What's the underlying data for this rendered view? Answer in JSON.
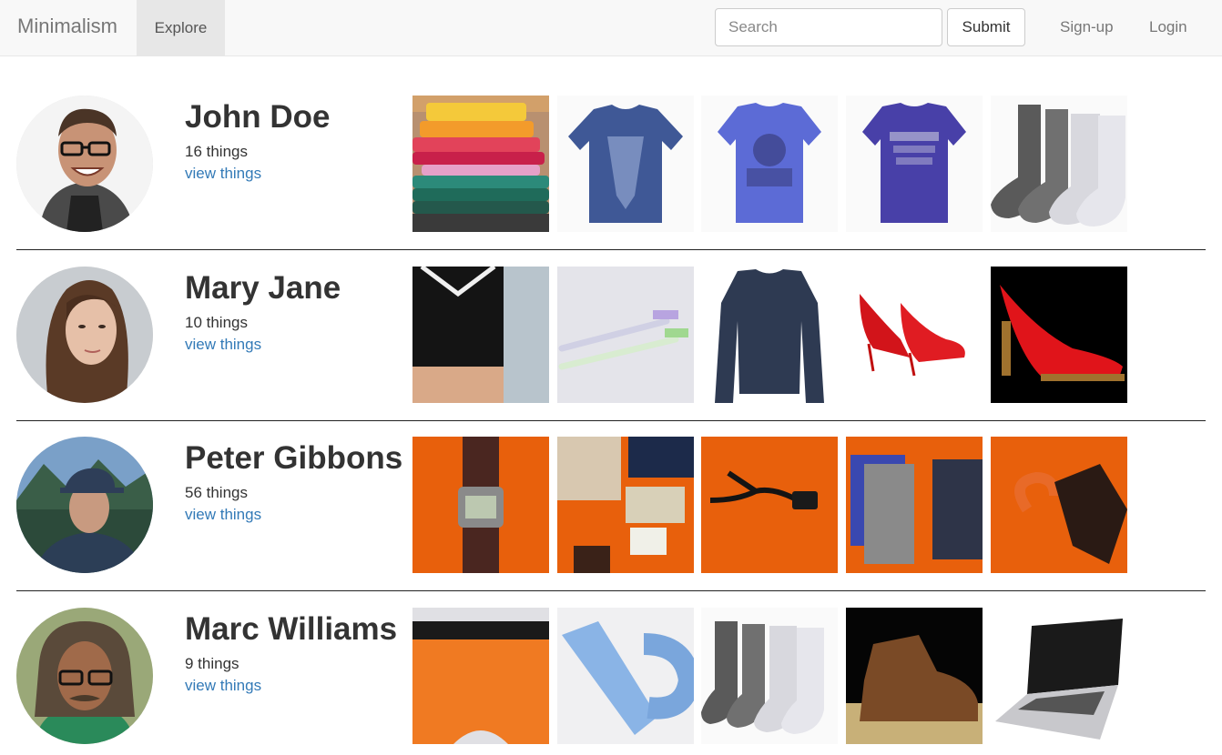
{
  "nav": {
    "brand": "Minimalism",
    "explore": "Explore",
    "search_placeholder": "Search",
    "submit": "Submit",
    "signup": "Sign-up",
    "login": "Login"
  },
  "users": [
    {
      "name": "John Doe",
      "count": "16 things",
      "link": "view things",
      "things": [
        "folded-shirts-photo",
        "eagle-tshirt-photo",
        "graphic-tshirt-photo",
        "bestsupply-tshirt-photo",
        "socks-photo"
      ]
    },
    {
      "name": "Mary Jane",
      "count": "10 things",
      "link": "view things",
      "things": [
        "sports-top-photo",
        "toothbrushes-photo",
        "sweater-photo",
        "red-heels-photo",
        "red-pump-photo"
      ]
    },
    {
      "name": "Peter Gibbons",
      "count": "56 things",
      "link": "view things",
      "things": [
        "watch-photo",
        "passport-wallet-photo",
        "charger-cable-photo",
        "underwear-photo",
        "umbrella-photo"
      ]
    },
    {
      "name": "Marc Williams",
      "count": "9 things",
      "link": "view things",
      "things": [
        "orange-briefs-photo",
        "blue-tie-photo",
        "socks-photo",
        "leather-boot-photo",
        "laptop-photo"
      ]
    }
  ]
}
